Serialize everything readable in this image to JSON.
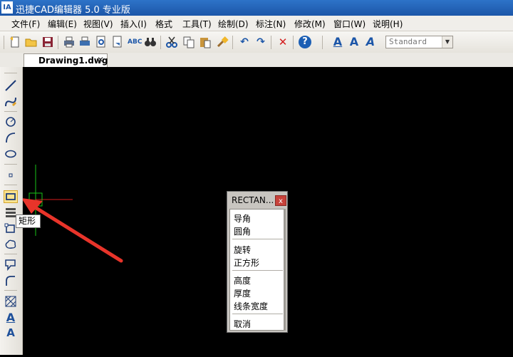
{
  "window": {
    "title": "迅捷CAD编辑器 5.0 专业版",
    "icon_text": "IA"
  },
  "menu": [
    {
      "label": "文件(F)"
    },
    {
      "label": "编辑(E)"
    },
    {
      "label": "视图(V)"
    },
    {
      "label": "插入(I)"
    },
    {
      "label": "格式"
    },
    {
      "label": "工具(T)"
    },
    {
      "label": "绘制(D)"
    },
    {
      "label": "标注(N)"
    },
    {
      "label": "修改(M)"
    },
    {
      "label": "窗口(W)"
    },
    {
      "label": "说明(H)"
    }
  ],
  "toolbar": {
    "text_style": "Standard",
    "glyphs": {
      "abc": "ABC",
      "text_a": "A",
      "help": "?",
      "delete": "✕",
      "undo": "↶",
      "redo": "↷"
    }
  },
  "tab": {
    "label": "Drawing1.dwg",
    "close": "✕"
  },
  "left_toolbar": {
    "text_a": "A",
    "tooltip": "矩形"
  },
  "context_menu": {
    "title": "RECTAN...",
    "close": "x",
    "items": [
      "导角",
      "圆角",
      "旋转",
      "正方形",
      "高度",
      "厚度",
      "线条宽度",
      "取消"
    ]
  },
  "colors": {
    "crosshair_v": "#17c317",
    "crosshair_h": "#d81d1d",
    "arrow": "#e8342a"
  }
}
